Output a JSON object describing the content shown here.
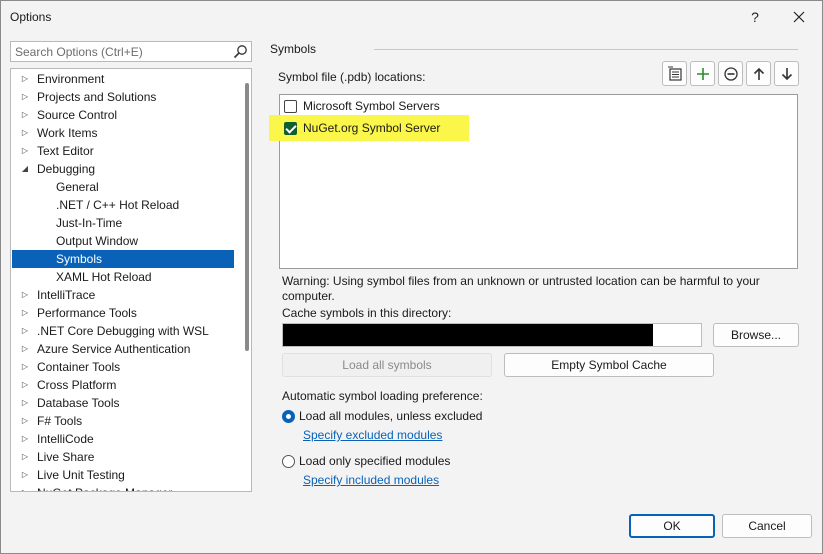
{
  "window": {
    "title": "Options",
    "help": "?",
    "close": "✕"
  },
  "search": {
    "placeholder": "Search Options (Ctrl+E)"
  },
  "tree": {
    "items": [
      {
        "label": "Environment",
        "arrow": "▷"
      },
      {
        "label": "Projects and Solutions",
        "arrow": "▷"
      },
      {
        "label": "Source Control",
        "arrow": "▷"
      },
      {
        "label": "Work Items",
        "arrow": "▷"
      },
      {
        "label": "Text Editor",
        "arrow": "▷"
      },
      {
        "label": "Debugging",
        "arrow": "◢"
      },
      {
        "label": "General",
        "arrow": ""
      },
      {
        "label": ".NET / C++ Hot Reload",
        "arrow": ""
      },
      {
        "label": "Just-In-Time",
        "arrow": ""
      },
      {
        "label": "Output Window",
        "arrow": ""
      },
      {
        "label": "Symbols",
        "arrow": ""
      },
      {
        "label": "XAML Hot Reload",
        "arrow": ""
      },
      {
        "label": "IntelliTrace",
        "arrow": "▷"
      },
      {
        "label": "Performance Tools",
        "arrow": "▷"
      },
      {
        "label": ".NET Core Debugging with WSL",
        "arrow": "▷"
      },
      {
        "label": "Azure Service Authentication",
        "arrow": "▷"
      },
      {
        "label": "Container Tools",
        "arrow": "▷"
      },
      {
        "label": "Cross Platform",
        "arrow": "▷"
      },
      {
        "label": "Database Tools",
        "arrow": "▷"
      },
      {
        "label": "F# Tools",
        "arrow": "▷"
      },
      {
        "label": "IntelliCode",
        "arrow": "▷"
      },
      {
        "label": "Live Share",
        "arrow": "▷"
      },
      {
        "label": "Live Unit Testing",
        "arrow": "▷"
      },
      {
        "label": "NuGet Package Manager",
        "arrow": "▷"
      }
    ]
  },
  "main": {
    "section_title": "Symbols",
    "locations_label": "Symbol file (.pdb) locations:",
    "toolbar_icons": [
      "load-symbols-icon",
      "add-icon",
      "remove-icon",
      "move-up-icon",
      "move-down-icon"
    ],
    "locations": [
      {
        "label": "Microsoft Symbol Servers",
        "checked": false
      },
      {
        "label": "NuGet.org Symbol Server",
        "checked": true
      }
    ],
    "highlight_color": "#fbf64a",
    "warning": "Warning: Using symbol files from an unknown or untrusted location can be harmful to your computer.",
    "cache_label": "Cache symbols in this directory:",
    "browse": "Browse...",
    "load_all": "Load all symbols",
    "empty_cache": "Empty Symbol Cache",
    "auto_label": "Automatic symbol loading preference:",
    "radio_all": "Load all modules, unless excluded",
    "link_excluded": "Specify excluded modules",
    "radio_specified": "Load only specified modules",
    "link_included": "Specify included modules"
  },
  "footer": {
    "ok": "OK",
    "cancel": "Cancel"
  },
  "colors": {
    "accent": "#0a62b8",
    "selection": "#0a62b8"
  }
}
